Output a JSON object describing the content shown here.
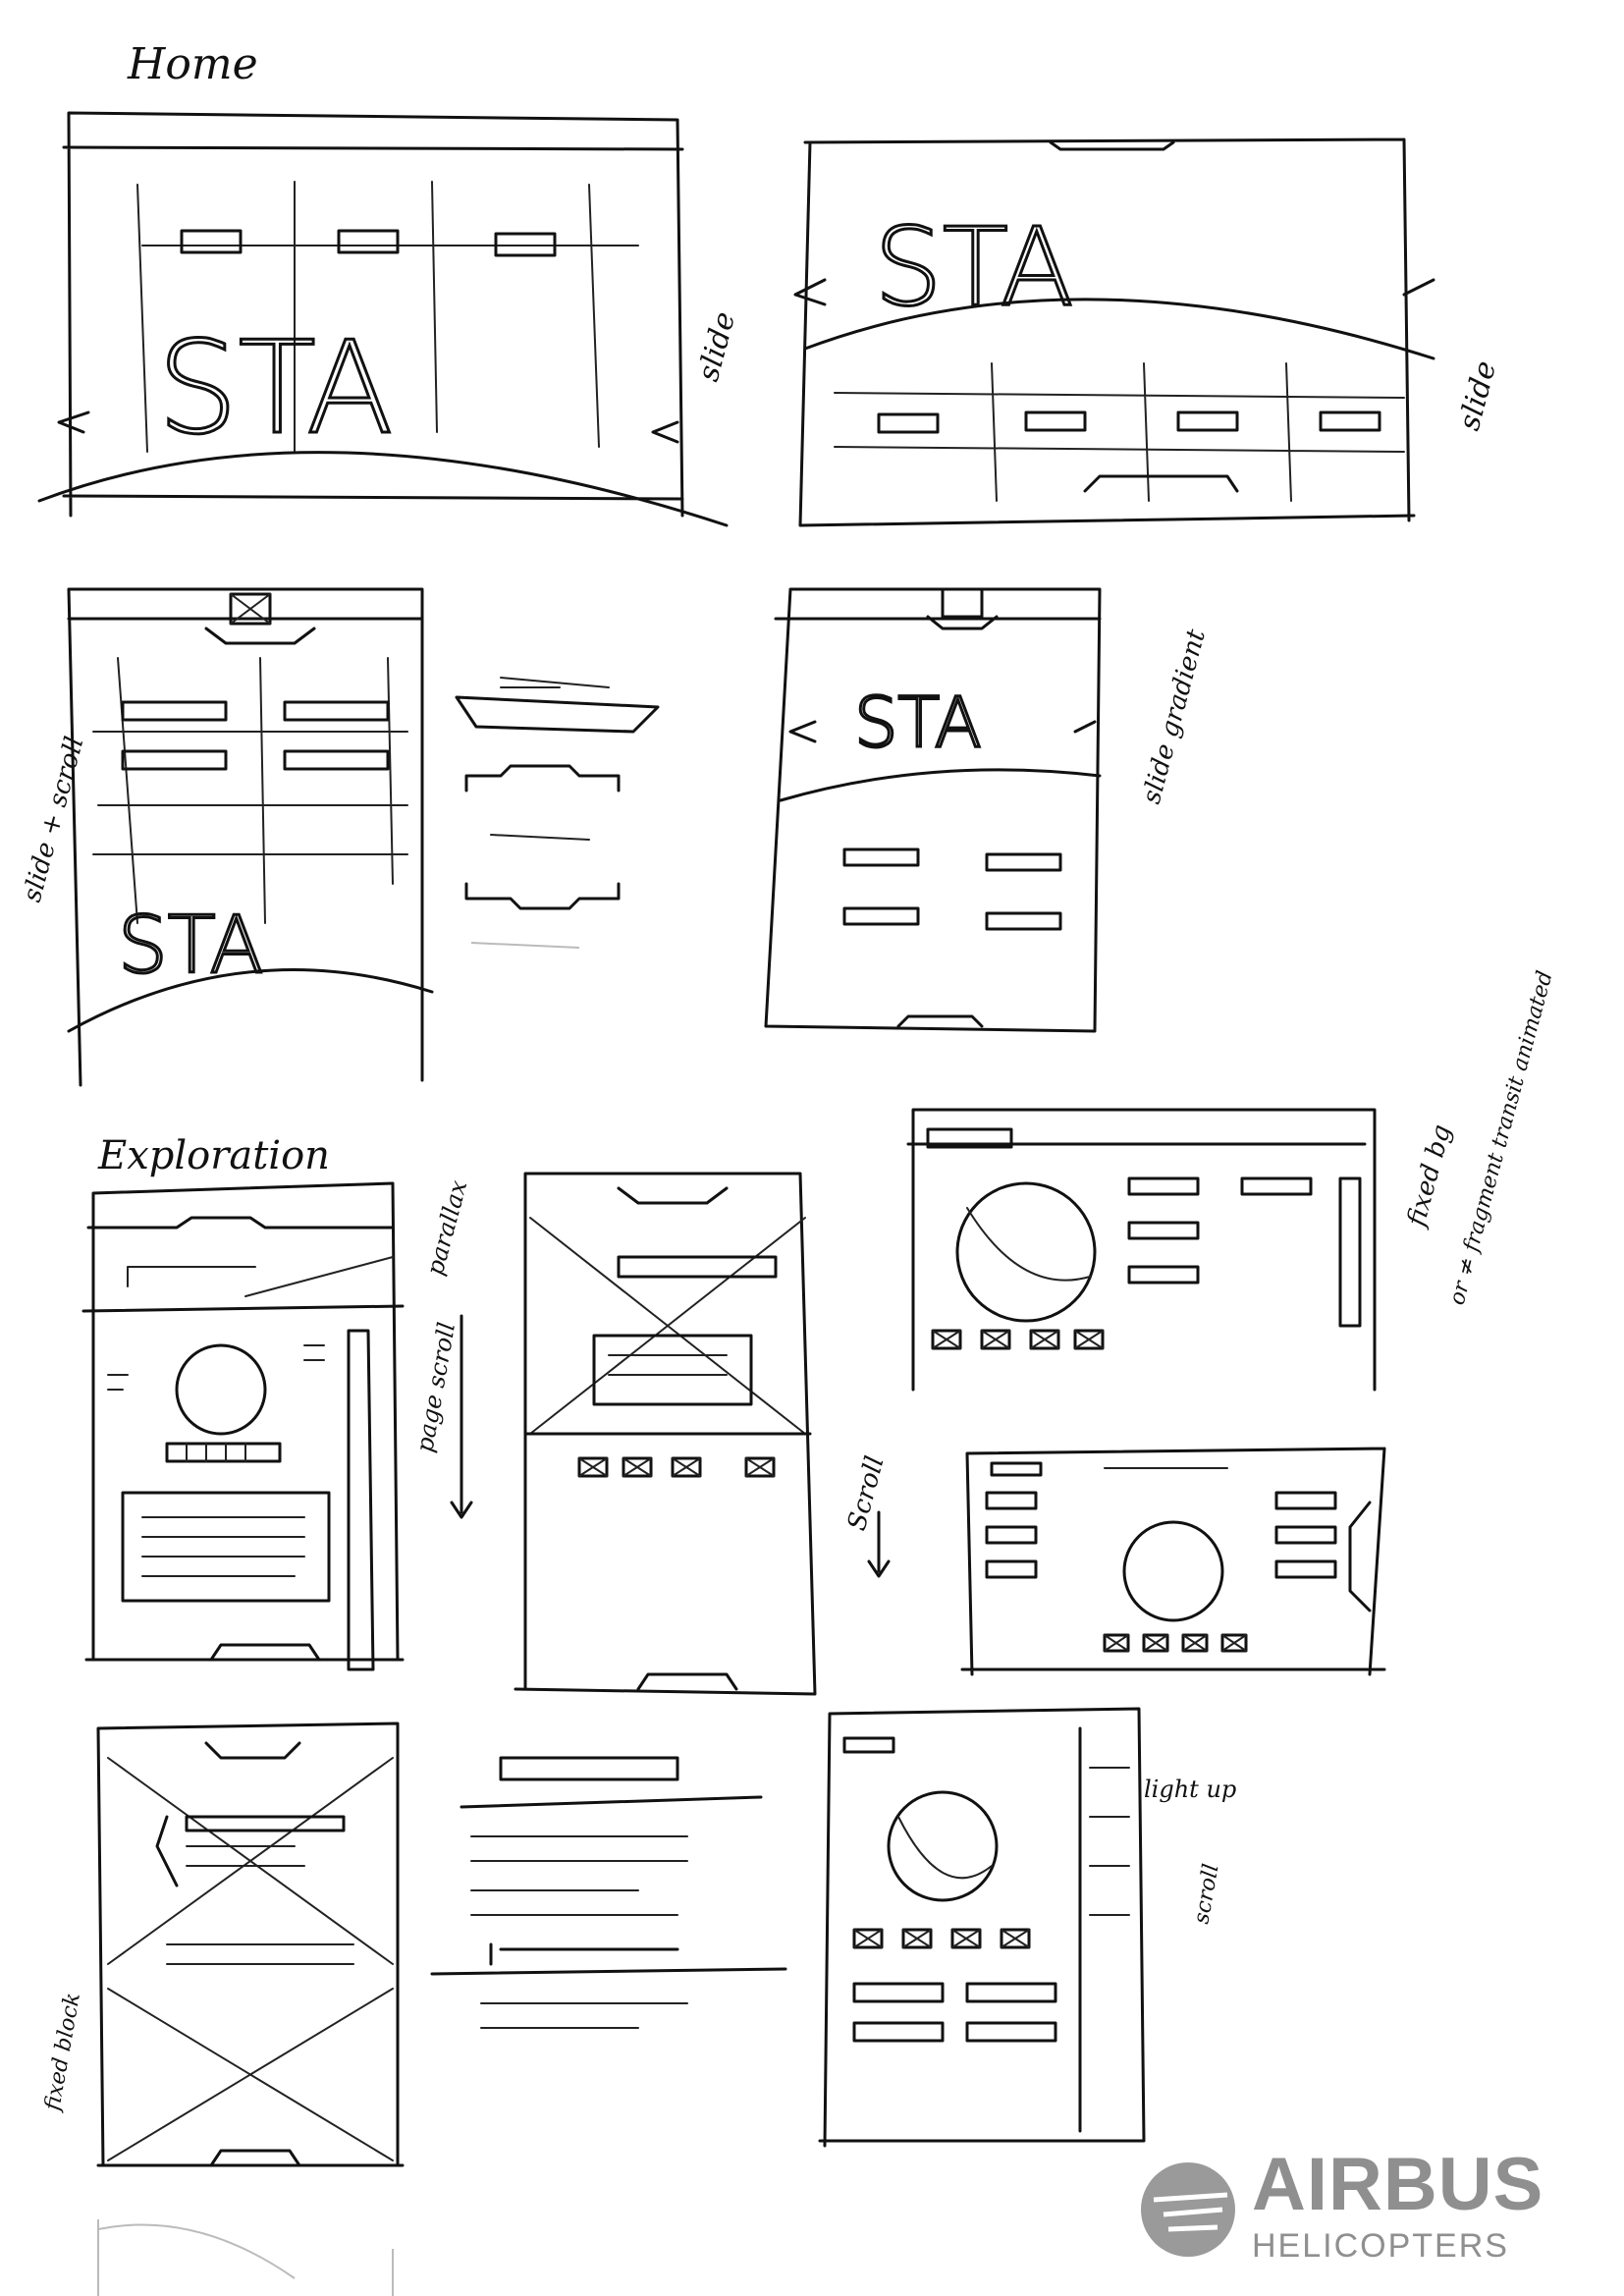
{
  "document": {
    "section_labels": {
      "home": "Home",
      "exploration": "Exploration"
    },
    "logo_text": "STA",
    "handwritten_notes": {
      "slide_1": "slide",
      "slide_2": "slide",
      "scroll_slide": "slide + scroll",
      "slide_gradient": "slide gradient",
      "parallax": "parallax",
      "page_scroll": "page scroll",
      "fixed_bg": "fixed bg",
      "or_fragment": "or ≠ fragment transit animated",
      "scroll": "Scroll",
      "light_up": "light up",
      "scroll_2": "scroll",
      "fixed_block": "fixed block"
    },
    "brand": {
      "name": "AIRBUS",
      "subtitle": "HELICOPTERS",
      "color": "#8f8f8f"
    }
  }
}
